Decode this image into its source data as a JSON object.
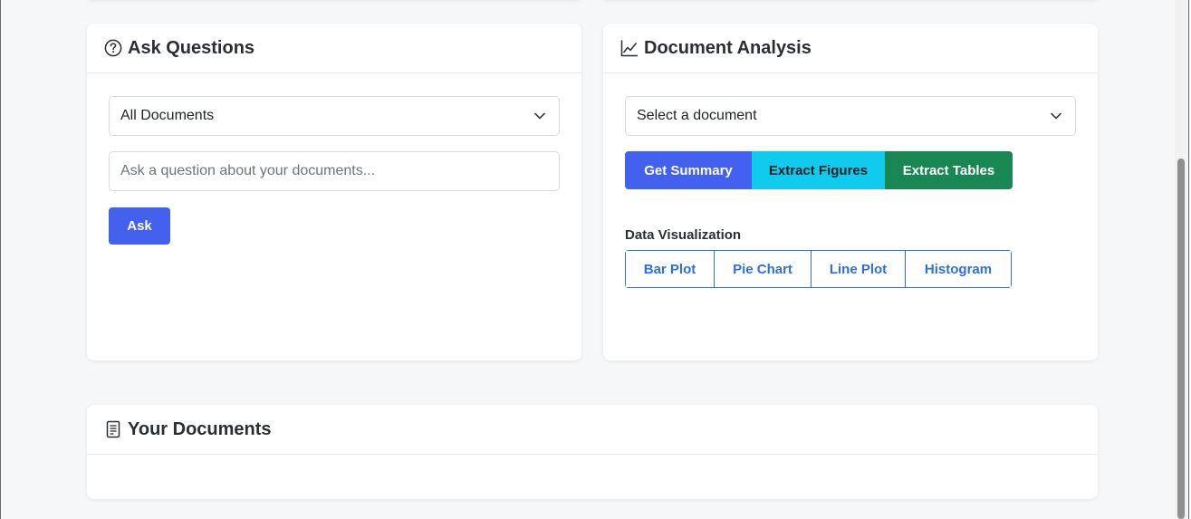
{
  "ask": {
    "title": "Ask Questions",
    "icon": "question-circle-icon",
    "scope_select": "All Documents",
    "question_placeholder": "Ask a question about your documents...",
    "ask_label": "Ask"
  },
  "analysis": {
    "title": "Document Analysis",
    "icon": "line-chart-icon",
    "document_select": "Select a document",
    "buttons": {
      "summary": "Get Summary",
      "figures": "Extract Figures",
      "tables": "Extract Tables"
    },
    "viz_label": "Data Visualization",
    "viz_buttons": [
      "Bar Plot",
      "Pie Chart",
      "Line Plot",
      "Histogram"
    ]
  },
  "documents": {
    "title": "Your Documents",
    "icon": "document-icon"
  },
  "colors": {
    "primary": "#4361ee",
    "info": "#11cbee",
    "success": "#198754",
    "outline": "#2f6fd6"
  }
}
